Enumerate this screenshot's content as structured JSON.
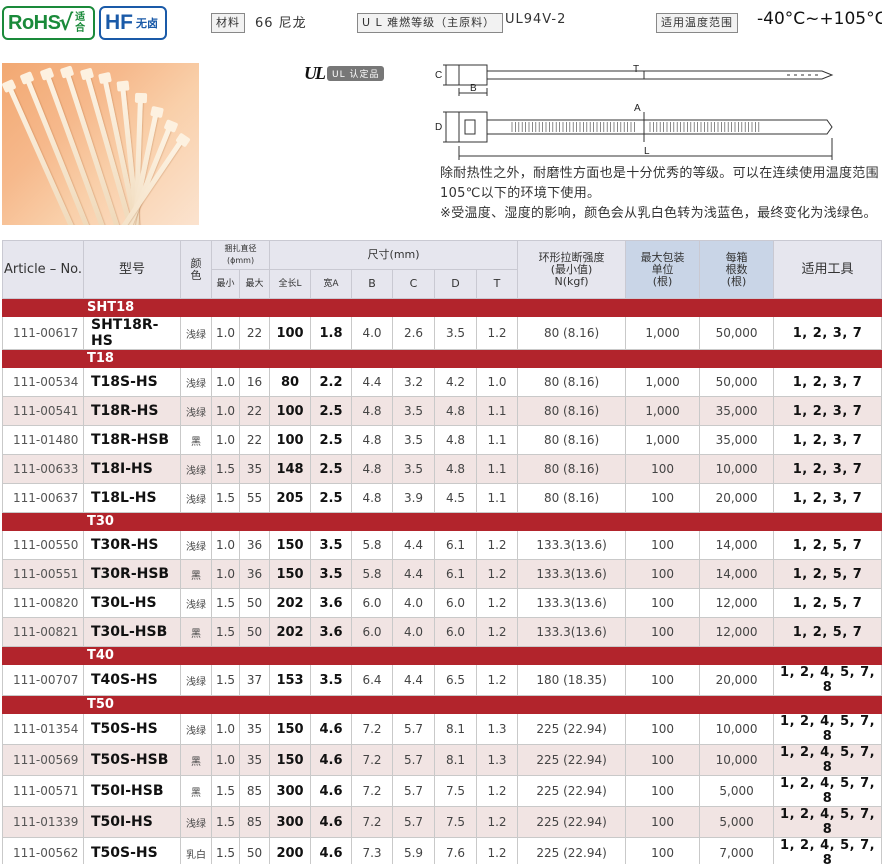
{
  "header": {
    "rohs_label": "RoHS",
    "rohs_check": "√",
    "rohs_comply": "适合",
    "hf_label": "HF",
    "hf_sub": "无卤",
    "material_label": "材料",
    "material_value": "66 尼龙",
    "ul_grade_label": "U L 难燃等级（主原料）",
    "ul_grade_value": "UL94V-2",
    "temp_label": "适用温度范围",
    "temp_value": "-40°C~+105°C"
  },
  "ul_mark": {
    "logo": "UL",
    "badge": "UL 认定品"
  },
  "diagram": {
    "labels": [
      "C",
      "B",
      "T",
      "D",
      "A",
      "L"
    ]
  },
  "description": [
    "除耐热性之外，耐磨性方面也是十分优秀的等级。可以在连续使用温度范围105℃以下的环境下使用。",
    "※受温度、湿度的影响，颜色会从乳白色转为浅蓝色，最终变化为浅绿色。"
  ],
  "table": {
    "headers": {
      "article": "Article – No.",
      "model": "型号",
      "color": "颜色",
      "bundle": "捆扎直径(ϕmm)",
      "bundle_min": "最小",
      "bundle_max": "最大",
      "size": "尺寸(mm)",
      "size_l": "全长L",
      "size_a": "宽A",
      "size_b": "B",
      "size_c": "C",
      "size_d": "D",
      "size_t": "T",
      "tensile": "环形拉断强度\n(最小值)\nN(kgf)",
      "pack": "最大包装\n单位\n(根)",
      "box": "每箱\n根数\n(根)",
      "tools": "适用工具"
    },
    "groups": [
      {
        "name": "SHT18",
        "rows": [
          [
            "111-00617",
            "SHT18R-HS",
            "浅绿",
            "1.0",
            "22",
            "100",
            "1.8",
            "4.0",
            "2.6",
            "3.5",
            "1.2",
            "80 (8.16)",
            "1,000",
            "50,000",
            "1, 2, 3, 7"
          ]
        ]
      },
      {
        "name": "T18",
        "rows": [
          [
            "111-00534",
            "T18S-HS",
            "浅绿",
            "1.0",
            "16",
            "80",
            "2.2",
            "4.4",
            "3.2",
            "4.2",
            "1.0",
            "80 (8.16)",
            "1,000",
            "50,000",
            "1, 2, 3, 7"
          ],
          [
            "111-00541",
            "T18R-HS",
            "浅绿",
            "1.0",
            "22",
            "100",
            "2.5",
            "4.8",
            "3.5",
            "4.8",
            "1.1",
            "80 (8.16)",
            "1,000",
            "35,000",
            "1, 2, 3, 7"
          ],
          [
            "111-01480",
            "T18R-HSB",
            "黑",
            "1.0",
            "22",
            "100",
            "2.5",
            "4.8",
            "3.5",
            "4.8",
            "1.1",
            "80 (8.16)",
            "1,000",
            "35,000",
            "1, 2, 3, 7"
          ],
          [
            "111-00633",
            "T18I-HS",
            "浅绿",
            "1.5",
            "35",
            "148",
            "2.5",
            "4.8",
            "3.5",
            "4.8",
            "1.1",
            "80 (8.16)",
            "100",
            "10,000",
            "1, 2, 3, 7"
          ],
          [
            "111-00637",
            "T18L-HS",
            "浅绿",
            "1.5",
            "55",
            "205",
            "2.5",
            "4.8",
            "3.9",
            "4.5",
            "1.1",
            "80 (8.16)",
            "100",
            "20,000",
            "1, 2, 3, 7"
          ]
        ]
      },
      {
        "name": "T30",
        "rows": [
          [
            "111-00550",
            "T30R-HS",
            "浅绿",
            "1.0",
            "36",
            "150",
            "3.5",
            "5.8",
            "4.4",
            "6.1",
            "1.2",
            "133.3(13.6)",
            "100",
            "14,000",
            "1, 2, 5, 7"
          ],
          [
            "111-00551",
            "T30R-HSB",
            "黑",
            "1.0",
            "36",
            "150",
            "3.5",
            "5.8",
            "4.4",
            "6.1",
            "1.2",
            "133.3(13.6)",
            "100",
            "14,000",
            "1, 2, 5, 7"
          ],
          [
            "111-00820",
            "T30L-HS",
            "浅绿",
            "1.5",
            "50",
            "202",
            "3.6",
            "6.0",
            "4.0",
            "6.0",
            "1.2",
            "133.3(13.6)",
            "100",
            "12,000",
            "1, 2, 5, 7"
          ],
          [
            "111-00821",
            "T30L-HSB",
            "黑",
            "1.5",
            "50",
            "202",
            "3.6",
            "6.0",
            "4.0",
            "6.0",
            "1.2",
            "133.3(13.6)",
            "100",
            "12,000",
            "1, 2, 5, 7"
          ]
        ]
      },
      {
        "name": "T40",
        "rows": [
          [
            "111-00707",
            "T40S-HS",
            "浅绿",
            "1.5",
            "37",
            "153",
            "3.5",
            "6.4",
            "4.4",
            "6.5",
            "1.2",
            "180 (18.35)",
            "100",
            "20,000",
            "1, 2, 4, 5, 7, 8"
          ]
        ]
      },
      {
        "name": "T50",
        "rows": [
          [
            "111-01354",
            "T50S-HS",
            "浅绿",
            "1.0",
            "35",
            "150",
            "4.6",
            "7.2",
            "5.7",
            "8.1",
            "1.3",
            "225 (22.94)",
            "100",
            "10,000",
            "1, 2, 4, 5, 7, 8"
          ],
          [
            "111-00569",
            "T50S-HSB",
            "黑",
            "1.0",
            "35",
            "150",
            "4.6",
            "7.2",
            "5.7",
            "8.1",
            "1.3",
            "225 (22.94)",
            "100",
            "10,000",
            "1, 2, 4, 5, 7, 8"
          ],
          [
            "111-00571",
            "T50I-HSB",
            "黑",
            "1.5",
            "85",
            "300",
            "4.6",
            "7.2",
            "5.7",
            "7.5",
            "1.2",
            "225 (22.94)",
            "100",
            "5,000",
            "1, 2, 4, 5, 7, 8"
          ],
          [
            "111-01339",
            "T50I-HS",
            "浅绿",
            "1.5",
            "85",
            "300",
            "4.6",
            "7.2",
            "5.7",
            "7.5",
            "1.2",
            "225 (22.94)",
            "100",
            "5,000",
            "1, 2, 4, 5, 7, 8"
          ],
          [
            "111-00562",
            "T50S-HS",
            "乳白",
            "1.5",
            "50",
            "200",
            "4.6",
            "7.3",
            "5.9",
            "7.6",
            "1.2",
            "225 (22.94)",
            "100",
            "7,000",
            "1, 2, 4, 5, 7, 8"
          ]
        ]
      }
    ]
  },
  "colors": {
    "group_bar": "#b2242c",
    "row_shade": "#f1e4e3",
    "header_bg": "#e6e6ee",
    "header_blue": "#c9d5e7",
    "rohs_green": "#1a8a3a",
    "hf_blue": "#1a5aa8"
  }
}
